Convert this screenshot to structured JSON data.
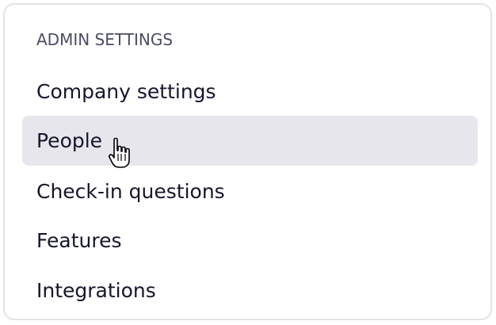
{
  "admin_settings": {
    "section_title": "ADMIN SETTINGS",
    "items": [
      {
        "label": "Company settings",
        "active": false
      },
      {
        "label": "People",
        "active": true
      },
      {
        "label": "Check-in questions",
        "active": false
      },
      {
        "label": "Features",
        "active": false
      },
      {
        "label": "Integrations",
        "active": false
      }
    ]
  },
  "cursor": {
    "icon": "hand-pointer-icon"
  },
  "colors": {
    "active_row_background": "#e7e6ec",
    "text_primary": "#15162b",
    "section_title": "#4b4d63",
    "panel_border": "#e3e3e8"
  }
}
